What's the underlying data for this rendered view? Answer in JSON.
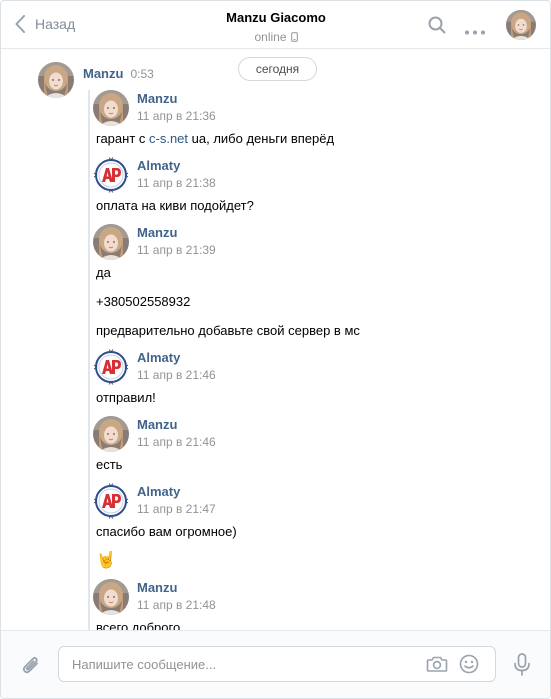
{
  "header": {
    "back_label": "Назад",
    "title": "Manzu Giacomo",
    "status": "online"
  },
  "date_pill": "сегодня",
  "main_message": {
    "author": "Manzu",
    "time": "0:53"
  },
  "forwarded": [
    {
      "author": "Manzu",
      "date": "11 апр в 21:36",
      "avatar": "girl"
    },
    {
      "author": "Almaty",
      "date": "11 апр в 21:38",
      "avatar": "logo"
    },
    {
      "author": "Manzu",
      "date": "11 апр в 21:39",
      "avatar": "girl"
    },
    {
      "author": "Almaty",
      "date": "11 апр в 21:46",
      "avatar": "logo"
    },
    {
      "author": "Manzu",
      "date": "11 апр в 21:46",
      "avatar": "girl"
    },
    {
      "author": "Almaty",
      "date": "11 апр в 21:47",
      "avatar": "logo"
    },
    {
      "author": "Manzu",
      "date": "11 апр в 21:48",
      "avatar": "girl"
    }
  ],
  "texts": {
    "t1_before": "гарант с ",
    "t1_link": "c-s.net",
    "t1_after": " ua, либо деньги вперёд",
    "t2": "оплата на киви подойдет?",
    "t3": "да",
    "t4": "+380502558932",
    "t5": "предварительно добавьте свой сервер в мс",
    "t6": "отправил!",
    "t7": "есть",
    "t8": "спасибо вам огромное)",
    "t9_emoji": "🤘",
    "t10": "всего доброго"
  },
  "composer": {
    "placeholder": "Напишите сообщение..."
  },
  "icons": {
    "back": "chevron-left-icon",
    "search": "search-icon",
    "more": "more-dots-icon",
    "phone": "mobile-phone-icon",
    "attach": "paperclip-icon",
    "camera": "camera-icon",
    "smile": "smile-icon",
    "mic": "microphone-icon"
  },
  "colors": {
    "name": "#42648b",
    "link": "#2a5885",
    "muted": "#939393",
    "border": "#e7e8ec"
  }
}
